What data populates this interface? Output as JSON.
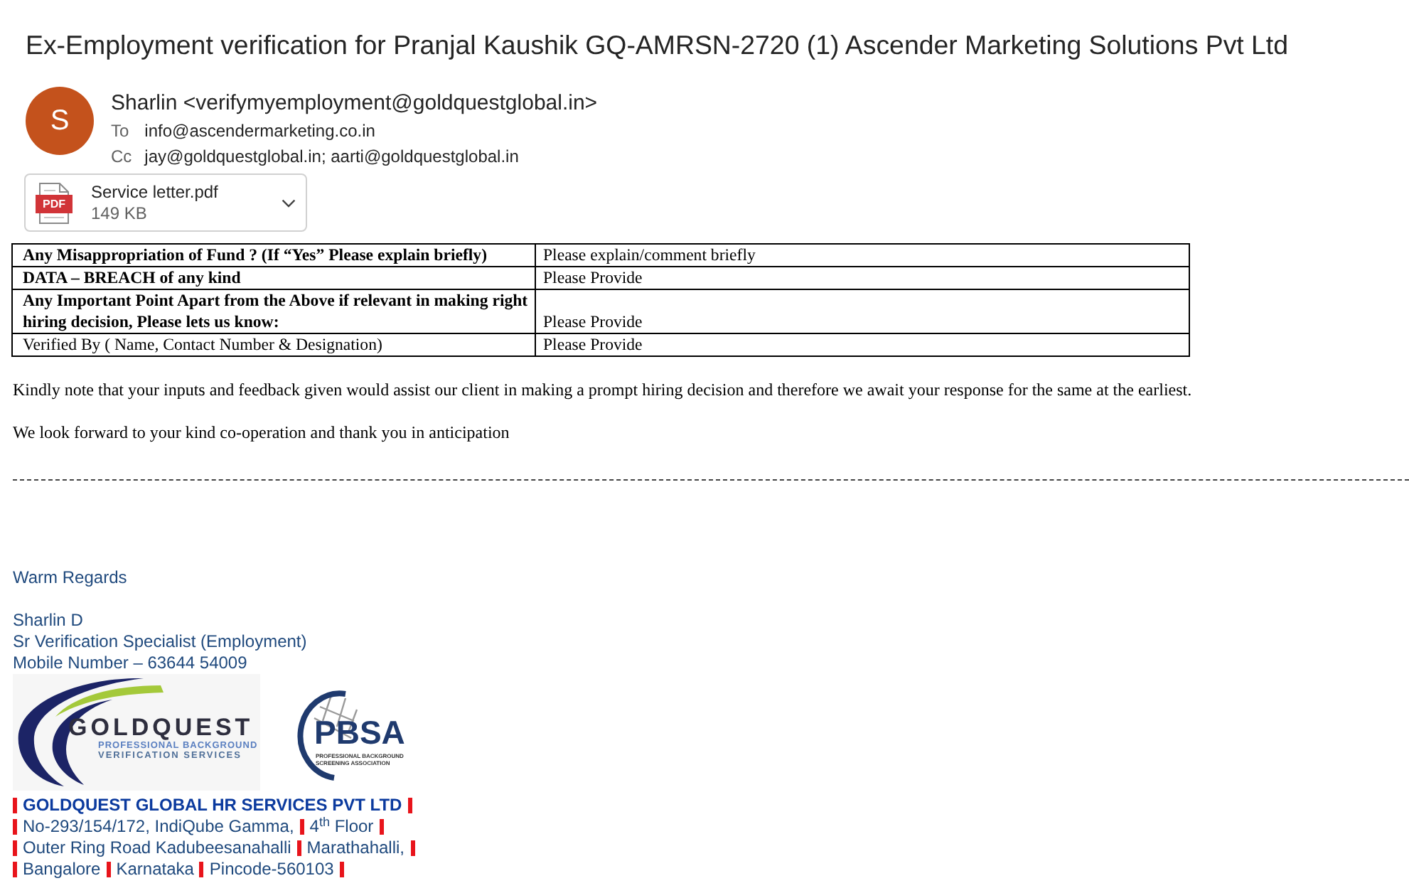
{
  "email": {
    "subject": "Ex-Employment verification for Pranjal Kaushik GQ-AMRSN-2720 (1) Ascender Marketing Solutions Pvt Ltd",
    "sender": {
      "initial": "S",
      "display": "Sharlin <verifymyemployment@goldquestglobal.in>"
    },
    "recipients": [
      {
        "label": "To",
        "value": "info@ascendermarketing.co.in"
      },
      {
        "label": "Cc",
        "value": "jay@goldquestglobal.in; aarti@goldquestglobal.in"
      }
    ],
    "attachments": [
      {
        "name": "Service letter.pdf",
        "size": "149 KB",
        "file_type": "PDF"
      }
    ]
  },
  "body": {
    "table": {
      "rows": [
        {
          "question": "Any Misappropriation of Fund ? (If “Yes” Please explain briefly)",
          "answer": "Please explain/comment briefly",
          "bold": true
        },
        {
          "question": "DATA – BREACH of any kind",
          "answer": "Please Provide",
          "bold": true
        },
        {
          "question": "Any Important Point Apart from the Above if relevant in making right hiring decision, Please lets us know:",
          "answer": "Please Provide",
          "bold": true
        },
        {
          "question": "Verified By ( Name, Contact Number & Designation)",
          "answer": "Please Provide",
          "bold": false
        }
      ]
    },
    "paragraphs": [
      "Kindly note that your inputs and feedback given would assist our client in making a prompt hiring decision and therefore we await your response for the same at the earliest.",
      "We look forward to your kind co-operation and thank you in anticipation"
    ]
  },
  "signature": {
    "closing": "Warm Regards",
    "lines": [
      "Sharlin D",
      "Sr Verification Specialist (Employment)",
      "Mobile Number – 63644 54009"
    ],
    "logos": [
      {
        "kind": "swoosh",
        "wordmark": "GOLDQUEST",
        "tagline": [
          "PROFESSIONAL BACKGROUND",
          "VERIFICATION SERVICES"
        ]
      },
      {
        "kind": "globe",
        "wordmark": "PBSA",
        "tagline": [
          "PROFESSIONAL BACKGROUND",
          "SCREENING ASSOCIATION"
        ]
      }
    ],
    "address": [
      {
        "bold": true,
        "parts": [
          "GOLDQUEST GLOBAL HR SERVICES PVT LTD"
        ]
      },
      {
        "bold": false,
        "parts": [
          "No-293/154/172, IndiQube Gamma,",
          "4$^{th}$ Floor"
        ]
      },
      {
        "bold": false,
        "parts": [
          "Outer Ring Road Kadubeesanahalli",
          "Marathahalli,"
        ]
      },
      {
        "bold": false,
        "parts": [
          "Bangalore",
          "Karnataka",
          "Pincode-560103"
        ]
      }
    ]
  }
}
